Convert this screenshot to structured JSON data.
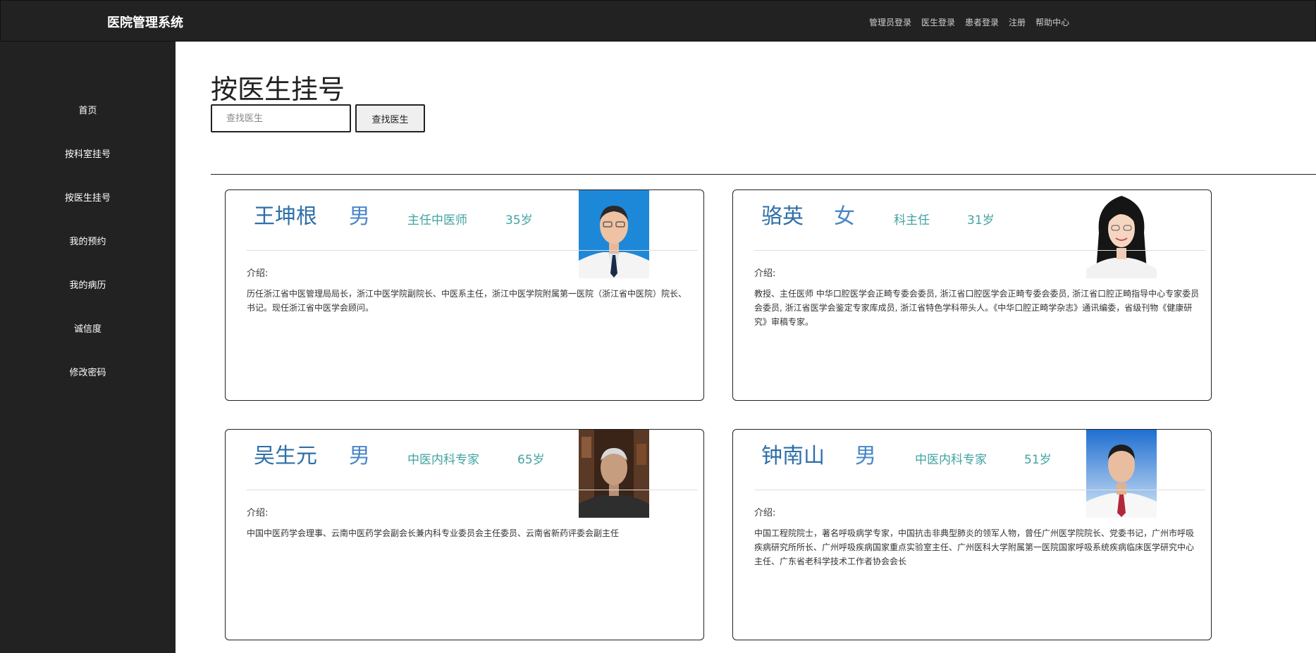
{
  "header": {
    "brand": "医院管理系统",
    "nav": [
      "管理员登录",
      "医生登录",
      "患者登录",
      "注册",
      "帮助中心"
    ]
  },
  "sidebar": {
    "items": [
      "首页",
      "按科室挂号",
      "按医生挂号",
      "我的预约",
      "我的病历",
      "诚信度",
      "修改密码"
    ]
  },
  "main": {
    "title": "按医生挂号",
    "search_placeholder": "查找医生",
    "search_button": "查找医生"
  },
  "doctors": [
    {
      "name": "王坤根",
      "gender": "男",
      "title": "主任中医师",
      "age": "35岁",
      "intro_label": "介绍:",
      "intro": "历任浙江省中医管理局局长，浙江中医学院副院长、中医系主任，浙江中医学院附属第一医院（浙江省中医院）院长、书记。现任浙江省中医学会顾问。"
    },
    {
      "name": "骆英",
      "gender": "女",
      "title": "科主任",
      "age": "31岁",
      "intro_label": "介绍:",
      "intro": "教授、主任医师 中华口腔医学会正畸专委会委员, 浙江省口腔医学会正畸专委会委员, 浙江省口腔正畸指导中心专家委员会委员, 浙江省医学会鉴定专家库成员, 浙江省特色学科带头人。《中华口腔正畸学杂志》通讯编委，省级刊物《健康研究》审稿专家。"
    },
    {
      "name": "吴生元",
      "gender": "男",
      "title": "中医内科专家",
      "age": "65岁",
      "intro_label": "介绍:",
      "intro": "中国中医药学会理事、云南中医药学会副会长兼内科专业委员会主任委员、云南省新药评委会副主任"
    },
    {
      "name": "钟南山",
      "gender": "男",
      "title": "中医内科专家",
      "age": "51岁",
      "intro_label": "介绍:",
      "intro": "中国工程院院士，著名呼吸病学专家，中国抗击非典型肺炎的领军人物，曾任广州医学院院长、党委书记，广州市呼吸疾病研究所所长、广州呼吸疾病国家重点实验室主任、广州医科大学附属第一医院国家呼吸系统疾病临床医学研究中心主任、广东省老科学技术工作者协会会长"
    }
  ]
}
